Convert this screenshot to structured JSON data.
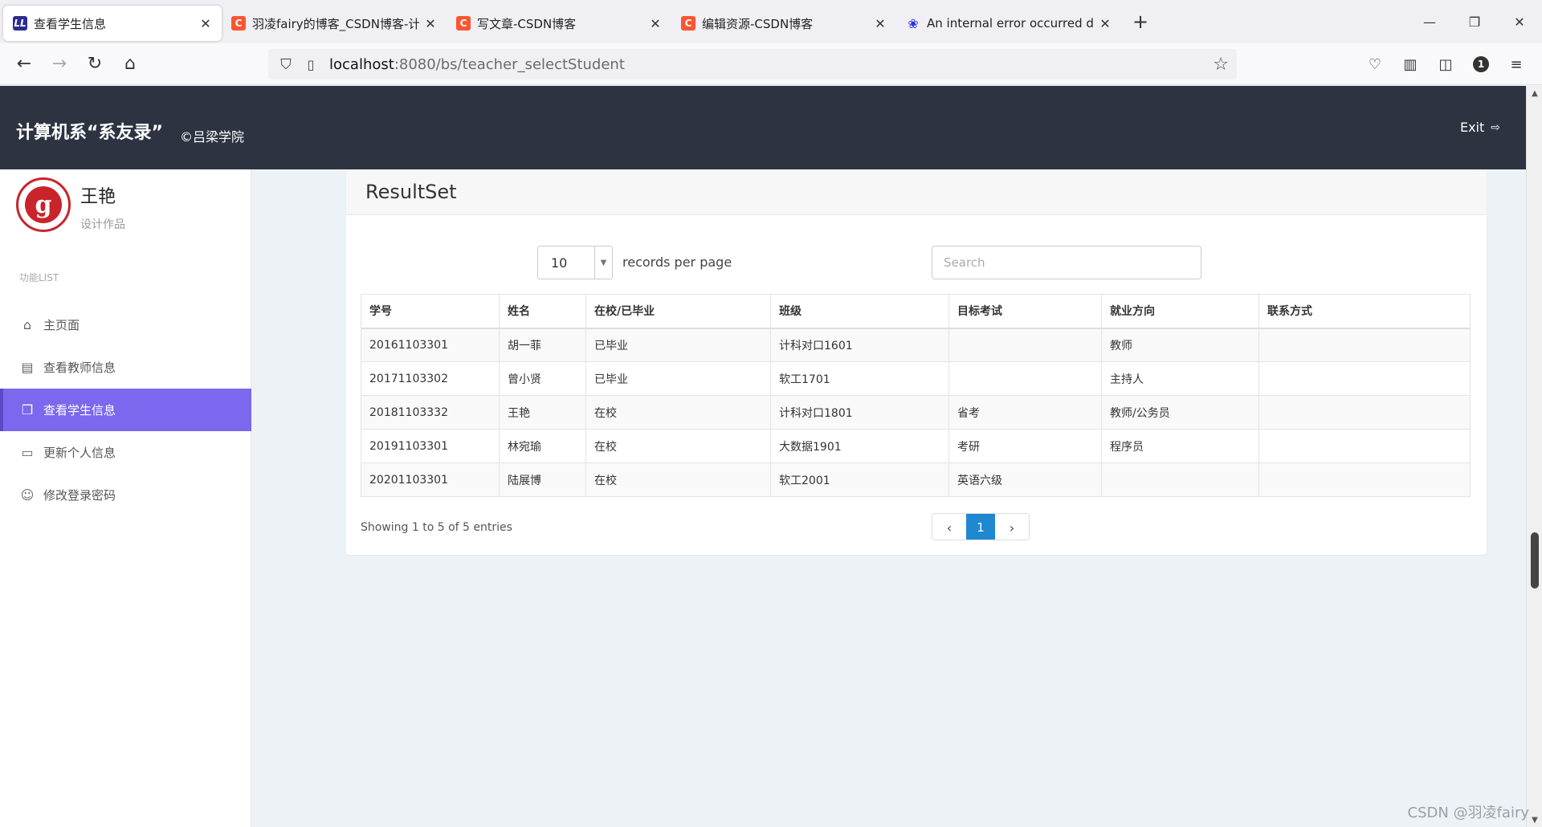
{
  "browser": {
    "tabs": [
      {
        "title": "查看学生信息",
        "favicon": "LL",
        "active": true
      },
      {
        "title": "羽凌fairy的博客_CSDN博客-计",
        "favicon": "C",
        "active": false
      },
      {
        "title": "写文章-CSDN博客",
        "favicon": "C",
        "active": false
      },
      {
        "title": "编辑资源-CSDN博客",
        "favicon": "C",
        "active": false
      },
      {
        "title": "An internal error occurred du",
        "favicon": "paw",
        "active": false
      }
    ],
    "url_host": "localhost",
    "url_rest": ":8080/bs/teacher_selectStudent",
    "toolbar_badge": "1"
  },
  "header": {
    "title": "计算机系“系友录”",
    "subtitle": "©吕梁学院",
    "exit_label": "Exit"
  },
  "sidebar": {
    "user_name": "王艳",
    "user_role": "设计作品",
    "menu_heading": "功能LIST",
    "items": [
      {
        "label": "主页面",
        "icon": "home-icon",
        "active": false
      },
      {
        "label": "查看教师信息",
        "icon": "document-icon",
        "active": false
      },
      {
        "label": "查看学生信息",
        "icon": "window-icon",
        "active": true
      },
      {
        "label": "更新个人信息",
        "icon": "id-card-icon",
        "active": false
      },
      {
        "label": "修改登录密码",
        "icon": "user-icon",
        "active": false
      }
    ]
  },
  "panel": {
    "title": "ResultSet",
    "page_length": "10",
    "page_length_label": "records per page",
    "search_placeholder": "Search",
    "columns": [
      "学号",
      "姓名",
      "在校/已毕业",
      "班级",
      "目标考试",
      "就业方向",
      "联系方式"
    ],
    "rows": [
      [
        "20161103301",
        "胡一菲",
        "已毕业",
        "计科对口1601",
        "",
        "教师",
        ""
      ],
      [
        "20171103302",
        "曾小贤",
        "已毕业",
        "软工1701",
        "",
        "主持人",
        ""
      ],
      [
        "20181103332",
        "王艳",
        "在校",
        "计科对口1801",
        "省考",
        "教师/公务员",
        ""
      ],
      [
        "20191103301",
        "林宛瑜",
        "在校",
        "大数据1901",
        "考研",
        "程序员",
        ""
      ],
      [
        "20201103301",
        "陆展博",
        "在校",
        "软工2001",
        "英语六级",
        "",
        ""
      ]
    ],
    "info": "Showing 1 to 5 of 5 entries",
    "current_page": "1"
  },
  "watermark": "CSDN @羽凌fairy",
  "colors": {
    "header_bg": "#2d3340",
    "active_menu": "#7b68ee",
    "pager_active": "#1e88d0",
    "logo_red": "#c9242b"
  }
}
